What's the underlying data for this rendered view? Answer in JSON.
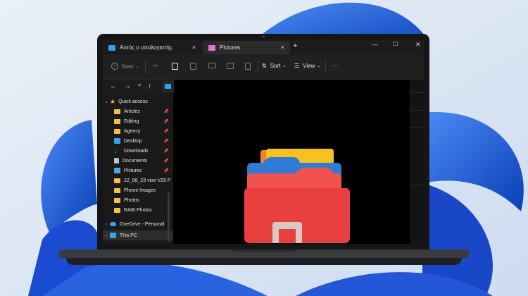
{
  "theme": {
    "wallpaper_bg": "#e4ecf6",
    "wallpaper_accent": "#1f5fd8",
    "accent": "#0078d4",
    "folder_yellow": "#f3c244"
  },
  "window": {
    "tabs": [
      {
        "label": "Αυτός ο υπολογιστής",
        "icon": "monitor-icon",
        "close": "×"
      },
      {
        "label": "Pictures",
        "icon": "pink-folder-icon",
        "close": "×"
      }
    ],
    "new_tab": "+",
    "controls": {
      "minimize": "—",
      "maximize": "☐",
      "close": "✕"
    }
  },
  "toolbar": {
    "new_label": "New",
    "sort_label": "Sort",
    "view_label": "View",
    "more_label": "···"
  },
  "nav": {
    "back": "←",
    "forward": "→",
    "recent": "⌄",
    "up": "↑"
  },
  "sidebar": {
    "quick_access": "Quick access",
    "items": [
      {
        "label": "Articles",
        "pinned": true
      },
      {
        "label": "Editing",
        "pinned": true
      },
      {
        "label": "Agency",
        "pinned": true
      },
      {
        "label": "Desktop",
        "pinned": true
      },
      {
        "label": "Downloads",
        "pinned": true
      },
      {
        "label": "Documents",
        "pinned": true
      },
      {
        "label": "Pictures",
        "pinned": true
      },
      {
        "label": "22_08_23 vivo V25 P",
        "pinned": false
      },
      {
        "label": "Phone Images",
        "pinned": false
      },
      {
        "label": "Photos",
        "pinned": false
      },
      {
        "label": "RAW Photos",
        "pinned": false
      }
    ],
    "onedrive": "OneDrive - Personal",
    "this_pc": "This PC",
    "pin_glyph": "📌"
  }
}
